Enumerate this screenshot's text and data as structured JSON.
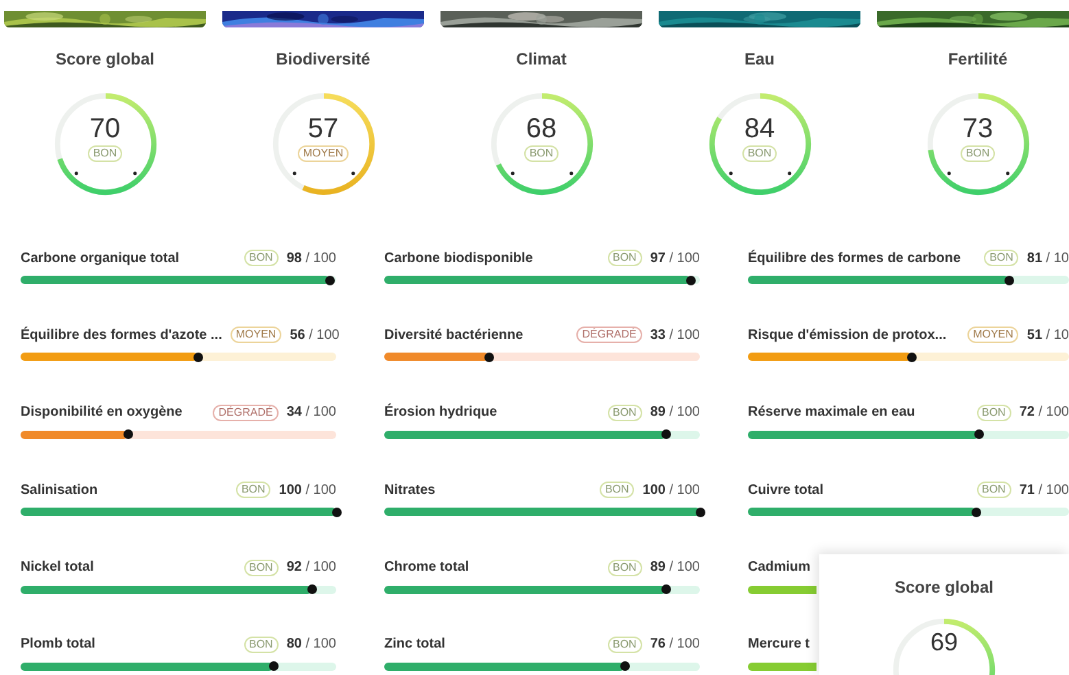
{
  "cards": [
    {
      "title": "Score global",
      "score": "70",
      "kind": "bon",
      "badge": "BON"
    },
    {
      "title": "Biodiversité",
      "score": "57",
      "kind": "moyen",
      "badge": "MOYEN"
    },
    {
      "title": "Climat",
      "score": "68",
      "kind": "bon",
      "badge": "BON"
    },
    {
      "title": "Eau",
      "score": "84",
      "kind": "bon",
      "badge": "BON"
    },
    {
      "title": "Fertilité",
      "score": "73",
      "kind": "bon",
      "badge": "BON"
    }
  ],
  "metric_columns": [
    {
      "rows": [
        {
          "label": "Carbone organique total",
          "kind": "bon",
          "badge": "BON",
          "score": "**98** / 100",
          "level": 0.98
        },
        {
          "label": "Équilibre des formes d'azote ...",
          "kind": "moyen",
          "badge": "MOYEN",
          "score": "**56** / 100",
          "level": 0.56
        },
        {
          "label": "Disponibilité en oxygène",
          "kind": "degrade",
          "badge": "DÉGRADÉ",
          "score": "**34** / 100",
          "level": 0.34
        },
        {
          "label": "Salinisation",
          "kind": "bon",
          "badge": "BON",
          "score": "**100** / 100",
          "level": 1.0
        },
        {
          "label": "Nickel total",
          "kind": "bon",
          "badge": "BON",
          "score": "**92** / 100",
          "level": 0.92
        },
        {
          "label": "Plomb total",
          "kind": "bon",
          "badge": "BON",
          "score": "**80** / 100",
          "level": 0.8
        }
      ]
    },
    {
      "rows": [
        {
          "label": "Carbone biodisponible",
          "kind": "bon",
          "badge": "BON",
          "score": "**97** / 100",
          "level": 0.97
        },
        {
          "label": "Diversité bactérienne",
          "kind": "degrade",
          "badge": "DÉGRADÉ",
          "score": "**33** / 100",
          "level": 0.33
        },
        {
          "label": "Érosion hydrique",
          "kind": "bon",
          "badge": "BON",
          "score": "**89** / 100",
          "level": 0.89
        },
        {
          "label": "Nitrates",
          "kind": "bon",
          "badge": "BON",
          "score": "**100** / 100",
          "level": 1.0
        },
        {
          "label": "Chrome total",
          "kind": "bon",
          "badge": "BON",
          "score": "**89** / 100",
          "level": 0.89
        },
        {
          "label": "Zinc total",
          "kind": "bon",
          "badge": "BON",
          "score": "**76** / 100",
          "level": 0.76
        }
      ]
    },
    {
      "rows": [
        {
          "label": "Équilibre des formes de carbone",
          "kind": "bon",
          "badge": "BON",
          "score": "**81** / 10",
          "level": 0.81
        },
        {
          "label": "Risque d'émission de protox...",
          "kind": "moyen",
          "badge": "MOYEN",
          "score": "**51** / 10",
          "level": 0.51
        },
        {
          "label": "Réserve maximale en eau",
          "kind": "bon",
          "badge": "BON",
          "score": "**72** / 100",
          "level": 0.72
        },
        {
          "label": "Cuivre total",
          "kind": "bon",
          "badge": "BON",
          "score": "**71** / 100",
          "level": 0.71
        },
        {
          "label": "Cadmium"
        },
        {
          "label": "Mercure t"
        }
      ]
    }
  ],
  "floating_card": {
    "title": "Score global",
    "score": "69",
    "kind": "bon"
  }
}
